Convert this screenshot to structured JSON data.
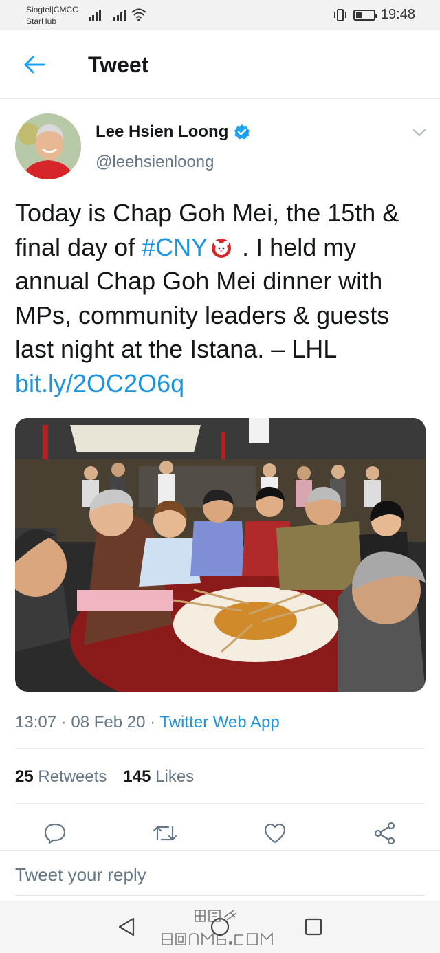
{
  "status_bar": {
    "carrier_1": "Singtel|CMCC",
    "carrier_2": "StarHub",
    "time": "19:48",
    "battery_level": 0.35
  },
  "header": {
    "title": "Tweet",
    "back_icon": "arrow-left-icon"
  },
  "author": {
    "name": "Lee Hsien Loong",
    "handle": "@leehsienloong",
    "verified": true,
    "verified_color": "#1da1f2"
  },
  "tweet": {
    "text_1": "Today is Chap Goh Mei, the 15th & final day of ",
    "hashtag": "#CNY",
    "text_2": " . I held my annual Chap Goh Mei dinner with MPs, community leaders & guests last night at the Istana. – LHL",
    "link": "bit.ly/2OC2O6q",
    "link_color": "#1b95e0"
  },
  "meta": {
    "time": "13:07",
    "separator": " · ",
    "date": "08 Feb 20",
    "source": "Twitter Web App"
  },
  "stats": {
    "retweets_count": "25",
    "retweets_label": "Retweets",
    "likes_count": "145",
    "likes_label": "Likes"
  },
  "actions": [
    "reply-icon",
    "retweet-icon",
    "like-icon",
    "share-icon"
  ],
  "reply": {
    "placeholder": "Tweet your reply"
  },
  "nav": [
    "back-triangle-icon",
    "home-circle-icon",
    "recents-square-icon"
  ]
}
